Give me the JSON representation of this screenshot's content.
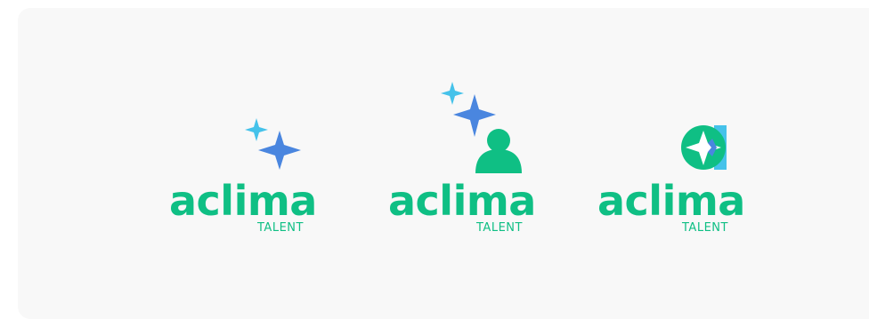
{
  "colors": {
    "panel_bg": "#f8f8f8",
    "brand_green": "#0fbf84",
    "star_blue": "#4a86df",
    "star_light_blue": "#45c2ea"
  },
  "logos": [
    {
      "id": "sparkle-version",
      "wordmark": "aclima",
      "subtitle": "TALENT",
      "icon": "sparkle-stars-icon"
    },
    {
      "id": "person-version",
      "wordmark": "aclima",
      "subtitle": "TALENT",
      "icon": "sparkle-person-icon"
    },
    {
      "id": "badge-version",
      "wordmark": "aclima",
      "subtitle": "TALENT",
      "icon": "circle-star-badge-icon"
    }
  ]
}
